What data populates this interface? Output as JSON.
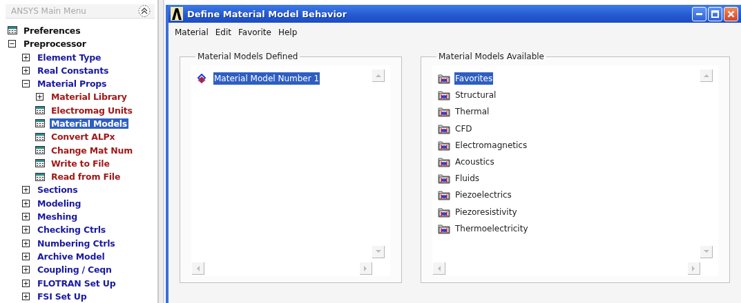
{
  "main_menu": {
    "title": "ANSYS Main Menu",
    "tree": [
      {
        "label": "Preferences",
        "kind": "dialog",
        "selected": false
      },
      {
        "label": "Preprocessor",
        "kind": "folder",
        "expanded": true,
        "selected": false,
        "children": [
          {
            "label": "Element Type",
            "kind": "folder",
            "expanded": false,
            "selected": false
          },
          {
            "label": "Real Constants",
            "kind": "folder",
            "expanded": false,
            "selected": false
          },
          {
            "label": "Material Props",
            "kind": "folder",
            "expanded": true,
            "selected": false,
            "children": [
              {
                "label": "Material Library",
                "kind": "folder",
                "expanded": false,
                "selected": false
              },
              {
                "label": "Electromag Units",
                "kind": "dialog",
                "selected": false
              },
              {
                "label": "Material Models",
                "kind": "dialog",
                "selected": true
              },
              {
                "label": "Convert ALPx",
                "kind": "dialog",
                "selected": false
              },
              {
                "label": "Change Mat Num",
                "kind": "dialog",
                "selected": false
              },
              {
                "label": "Write to File",
                "kind": "dialog",
                "selected": false
              },
              {
                "label": "Read from File",
                "kind": "dialog",
                "selected": false
              }
            ]
          },
          {
            "label": "Sections",
            "kind": "folder",
            "expanded": false,
            "selected": false
          },
          {
            "label": "Modeling",
            "kind": "folder",
            "expanded": false,
            "selected": false
          },
          {
            "label": "Meshing",
            "kind": "folder",
            "expanded": false,
            "selected": false
          },
          {
            "label": "Checking Ctrls",
            "kind": "folder",
            "expanded": false,
            "selected": false
          },
          {
            "label": "Numbering Ctrls",
            "kind": "folder",
            "expanded": false,
            "selected": false
          },
          {
            "label": "Archive Model",
            "kind": "folder",
            "expanded": false,
            "selected": false
          },
          {
            "label": "Coupling / Ceqn",
            "kind": "folder",
            "expanded": false,
            "selected": false
          },
          {
            "label": "FLOTRAN Set Up",
            "kind": "folder",
            "expanded": false,
            "selected": false
          },
          {
            "label": "FSI Set Up",
            "kind": "folder",
            "expanded": false,
            "selected": false
          }
        ]
      }
    ]
  },
  "window": {
    "title": "Define Material Model Behavior",
    "menu": [
      "Material",
      "Edit",
      "Favorite",
      "Help"
    ],
    "models_defined": {
      "title": "Material Models Defined",
      "items": [
        {
          "label": "Material Model Number 1",
          "selected": true
        }
      ]
    },
    "models_available": {
      "title": "Material Models Available",
      "items": [
        {
          "label": "Favorites",
          "selected": true
        },
        {
          "label": "Structural",
          "selected": false
        },
        {
          "label": "Thermal",
          "selected": false
        },
        {
          "label": "CFD",
          "selected": false
        },
        {
          "label": "Electromagnetics",
          "selected": false
        },
        {
          "label": "Acoustics",
          "selected": false
        },
        {
          "label": "Fluids",
          "selected": false
        },
        {
          "label": "Piezoelectrics",
          "selected": false
        },
        {
          "label": "Piezoresistivity",
          "selected": false
        },
        {
          "label": "Thermoelectricity",
          "selected": false
        }
      ]
    }
  }
}
